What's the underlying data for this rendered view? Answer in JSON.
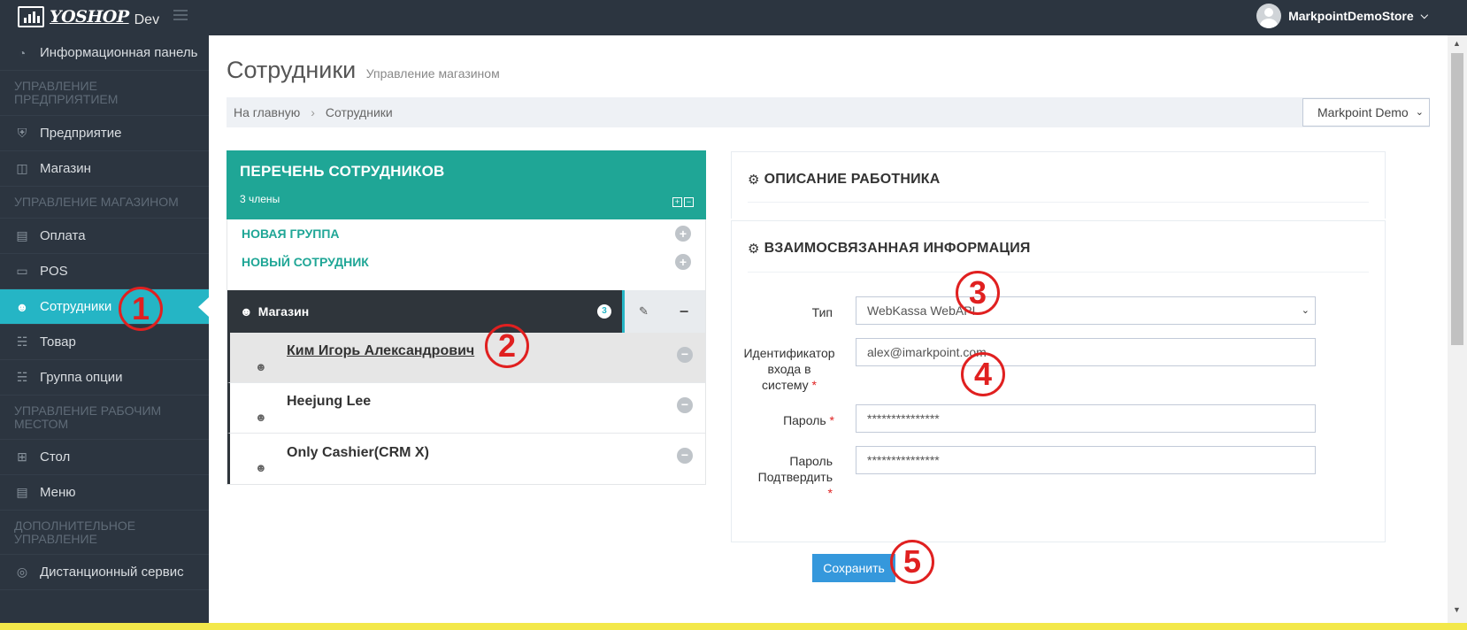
{
  "header": {
    "logo_text": "YOSHOP",
    "env_label": "Dev",
    "user_name": "MarkpointDemoStore"
  },
  "sidebar": {
    "items": [
      {
        "label": "Информационная панель",
        "icon": "dashboard-icon"
      },
      {
        "section": "УПРАВЛЕНИЕ ПРЕДПРИЯТИЕМ"
      },
      {
        "label": "Предприятие",
        "icon": "shield-icon"
      },
      {
        "label": "Магазин",
        "icon": "store-icon"
      },
      {
        "section": "УПРАВЛЕНИЕ МАГАЗИНОМ"
      },
      {
        "label": "Оплата",
        "icon": "card-icon"
      },
      {
        "label": "POS",
        "icon": "pos-icon"
      },
      {
        "label": "Сотрудники",
        "icon": "user-icon",
        "active": true
      },
      {
        "label": "Товар",
        "icon": "cart-icon"
      },
      {
        "label": "Группа опции",
        "icon": "cart-icon"
      },
      {
        "section": "УПРАВЛЕНИЕ РАБОЧИМ МЕСТОМ"
      },
      {
        "label": "Стол",
        "icon": "grid-icon"
      },
      {
        "label": "Меню",
        "icon": "book-icon"
      },
      {
        "section": "ДОПОЛНИТЕЛЬНОЕ УПРАВЛЕНИЕ"
      },
      {
        "label": "Дистанционный сервис",
        "icon": "lifebuoy-icon"
      }
    ]
  },
  "page": {
    "title": "Сотрудники",
    "subtitle": "Управление магазином",
    "breadcrumb_home": "На главную",
    "breadcrumb_current": "Сотрудники",
    "store_select_value": "Markpoint Demo"
  },
  "employee_list": {
    "title": "ПЕРЕЧЕНЬ СОТРУДНИКОВ",
    "count": "3 члены",
    "new_group": "НОВАЯ ГРУППА",
    "new_employee": "НОВЫЙ СОТРУДНИК",
    "group_name": "Магазин",
    "group_count": "3",
    "employees": [
      {
        "name": "Ким Игорь Александрович",
        "selected": true
      },
      {
        "name": "Heejung Lee",
        "selected": false
      },
      {
        "name": "Only Cashier(CRM X)",
        "selected": false
      }
    ]
  },
  "details": {
    "desc_title": "ОПИСАНИЕ РАБОТНИКА",
    "info_title": "ВЗАИМОСВЯЗАННАЯ ИНФОРМАЦИЯ",
    "type_label": "Тип",
    "type_value": "WebKassa WebAPI",
    "login_label_1": "Идентификатор",
    "login_label_2": "входа в",
    "login_label_3": "систему",
    "login_value": "alex@imarkpoint.com",
    "password_label": "Пароль",
    "password_value": "***************",
    "confirm_label_1": "Пароль",
    "confirm_label_2": "Подтвердить",
    "confirm_value": "***************",
    "required_mark": "*",
    "save_label": "Сохранить"
  },
  "annotations": [
    "1",
    "2",
    "3",
    "4",
    "5"
  ],
  "colors": {
    "sidebar_bg": "#2c3540",
    "accent": "#25b5c5",
    "list_header": "#1fa696",
    "save_button": "#3598dc",
    "annotation": "#e02020"
  }
}
